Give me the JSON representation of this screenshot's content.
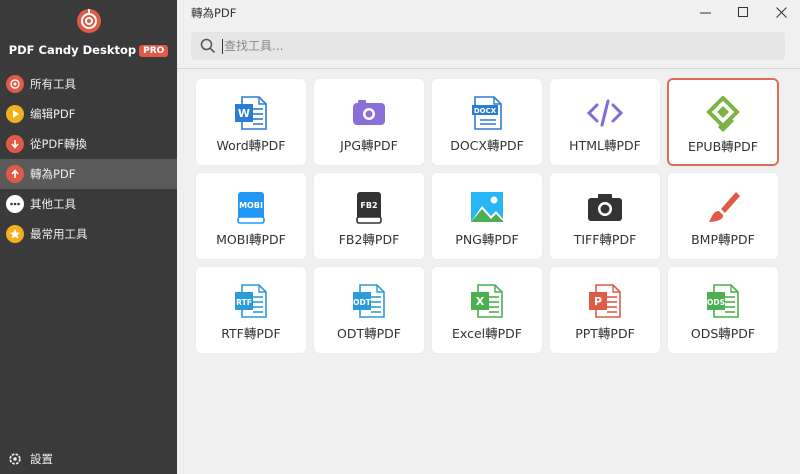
{
  "app": {
    "name": "PDF Candy Desktop",
    "badge": "PRO"
  },
  "window": {
    "title": "轉為PDF",
    "controls": [
      "–",
      "☐",
      "✕"
    ]
  },
  "sidebar": {
    "items": [
      {
        "label": "所有工具",
        "icon": "target-icon",
        "color": "#e05a48",
        "active": false
      },
      {
        "label": "编辑PDF",
        "icon": "play-icon",
        "color": "#f2b01e",
        "active": false
      },
      {
        "label": "從PDF轉換",
        "icon": "arrow-down-icon",
        "color": "#e05a48",
        "active": false
      },
      {
        "label": "轉為PDF",
        "icon": "arrow-up-icon",
        "color": "#e05a48",
        "active": true
      },
      {
        "label": "其他工具",
        "icon": "more-icon",
        "color": "#ffffff",
        "active": false
      },
      {
        "label": "最常用工具",
        "icon": "star-icon",
        "color": "#f2b01e",
        "active": false
      }
    ],
    "settings_label": "設置"
  },
  "search": {
    "placeholder": "查找工具..."
  },
  "tools": [
    {
      "label": "Word轉PDF",
      "icon": "word-icon",
      "color": "#2b7cd3",
      "selected": false
    },
    {
      "label": "JPG轉PDF",
      "icon": "jpg-icon",
      "color": "#8a6fd8",
      "selected": false
    },
    {
      "label": "DOCX轉PDF",
      "icon": "docx-icon",
      "color": "#2b7cd3",
      "selected": false
    },
    {
      "label": "HTML轉PDF",
      "icon": "html-icon",
      "color": "#7b6fd8",
      "selected": false
    },
    {
      "label": "EPUB轉PDF",
      "icon": "epub-icon",
      "color": "#7cb342",
      "selected": true
    },
    {
      "label": "MOBI轉PDF",
      "icon": "mobi-icon",
      "color": "#2196f3",
      "selected": false
    },
    {
      "label": "FB2轉PDF",
      "icon": "fb2-icon",
      "color": "#333333",
      "selected": false
    },
    {
      "label": "PNG轉PDF",
      "icon": "png-icon",
      "color": "#29b6f6",
      "selected": false
    },
    {
      "label": "TIFF轉PDF",
      "icon": "tiff-icon",
      "color": "#333333",
      "selected": false
    },
    {
      "label": "BMP轉PDF",
      "icon": "bmp-icon",
      "color": "#e05a48",
      "selected": false
    },
    {
      "label": "RTF轉PDF",
      "icon": "rtf-icon",
      "color": "#2b9cd8",
      "selected": false
    },
    {
      "label": "ODT轉PDF",
      "icon": "odt-icon",
      "color": "#2b9cd8",
      "selected": false
    },
    {
      "label": "Excel轉PDF",
      "icon": "excel-icon",
      "color": "#4caf50",
      "selected": false
    },
    {
      "label": "PPT轉PDF",
      "icon": "ppt-icon",
      "color": "#e05a48",
      "selected": false
    },
    {
      "label": "ODS轉PDF",
      "icon": "ods-icon",
      "color": "#4caf50",
      "selected": false
    }
  ]
}
